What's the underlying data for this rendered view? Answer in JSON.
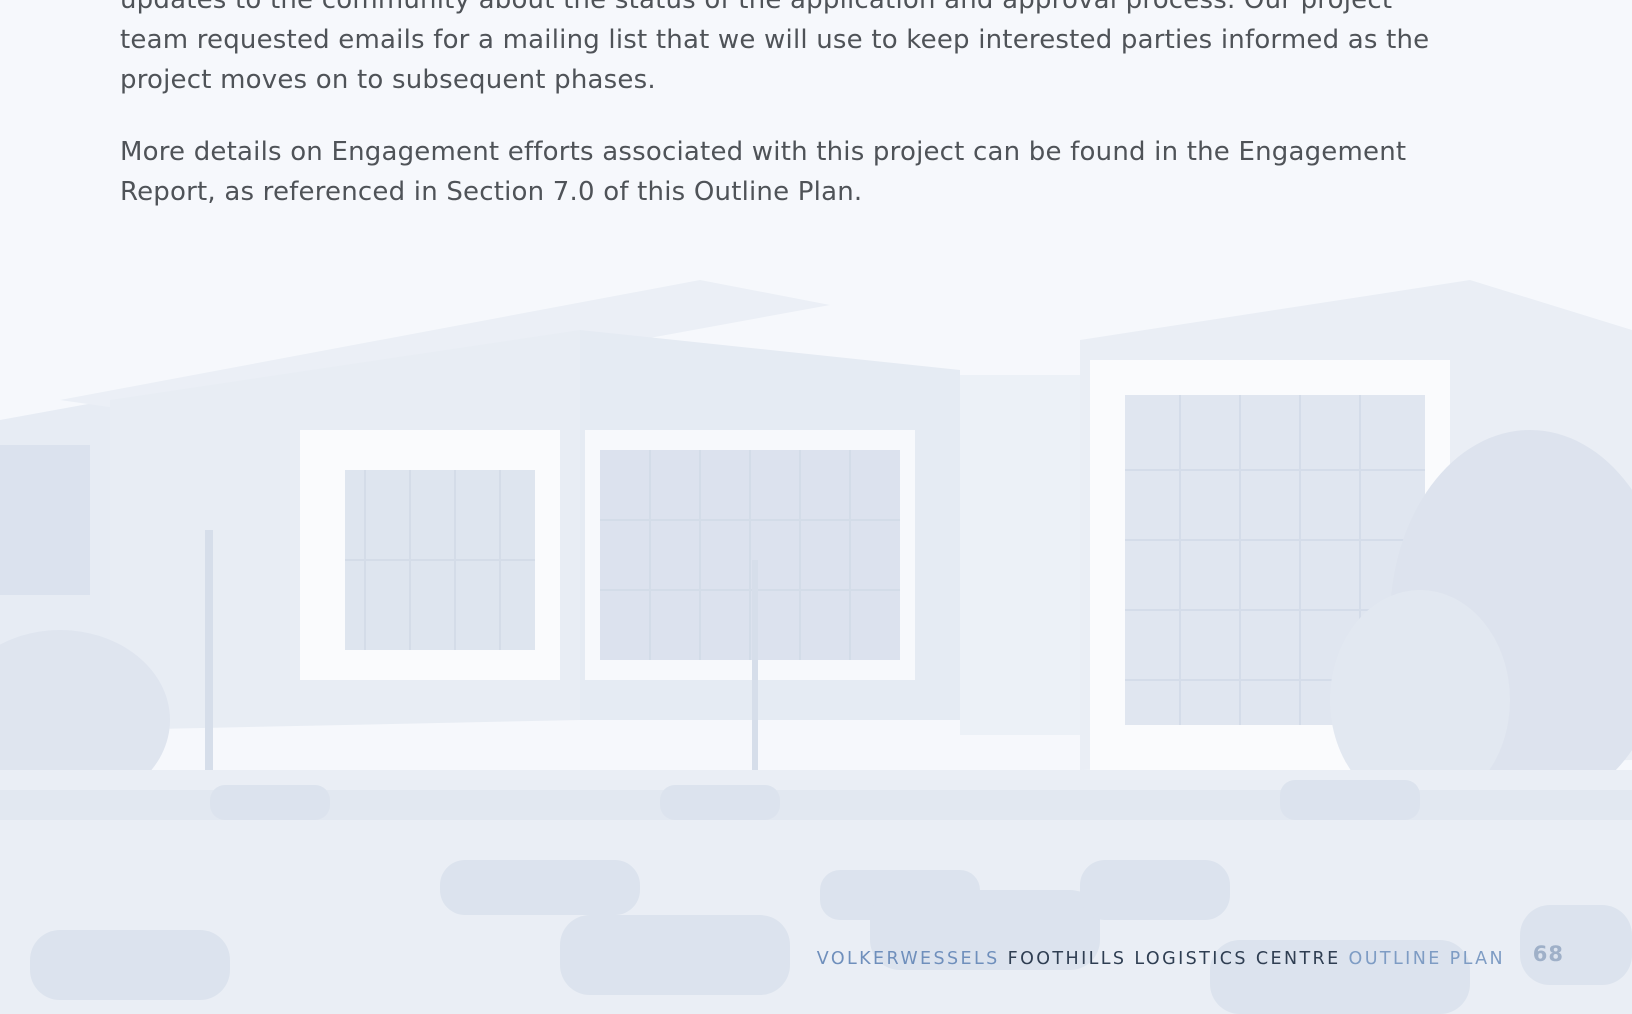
{
  "paragraphs": {
    "p1": "updates to the community about the status of the application and approval process. Our project team requested emails for a mailing list that we will use to keep interested parties informed as the project moves on to subsequent phases.",
    "p2": "More details on Engagement efforts associated with this project can be found in the Engagement Report, as referenced in Section 7.0 of this Outline Plan."
  },
  "footer": {
    "brand": "VOLKERWESSELS",
    "project": "FOOTHILLS LOGISTICS CENTRE",
    "doc": "OUTLINE PLAN",
    "page_number": "68"
  },
  "colors": {
    "body_text": "#4f5358",
    "footer_brand": "#6f8fbc",
    "footer_project": "#2f3e52",
    "footer_doc": "#7e9cc4",
    "page_number": "#9fb0c8"
  }
}
